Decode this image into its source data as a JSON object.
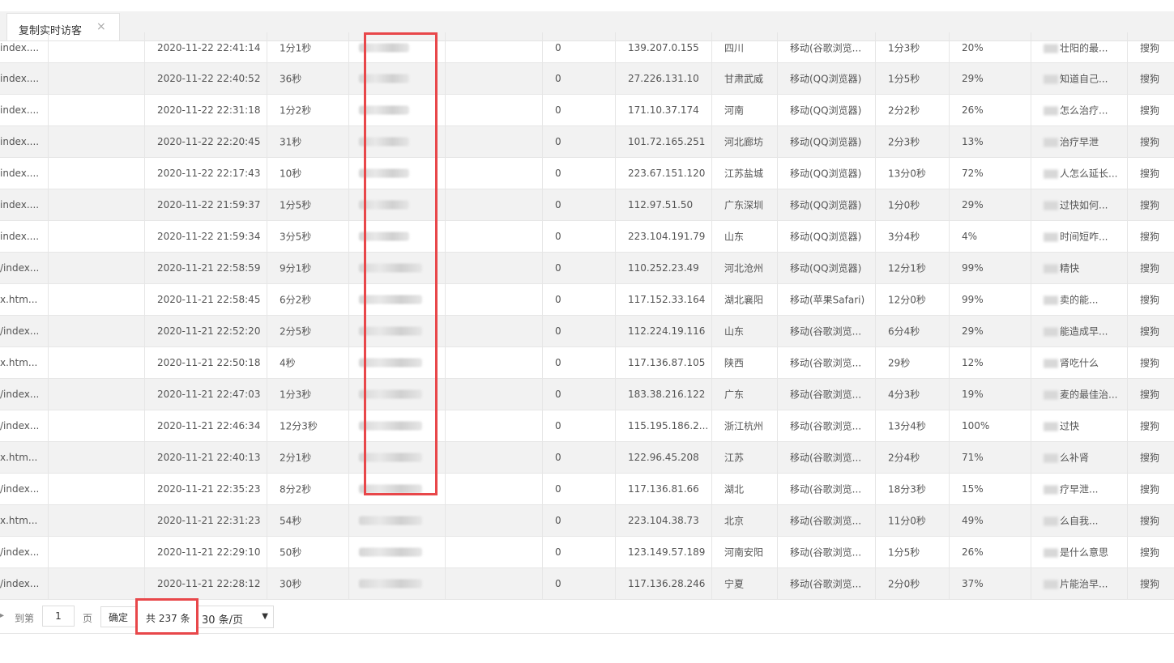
{
  "tab": {
    "label": "复制实时访客",
    "close": "×"
  },
  "rows": [
    {
      "page": "index....",
      "time": "2020-11-22 22:41:14",
      "dur": "1分1秒",
      "visits": "0",
      "ip": "139.207.0.155",
      "region": "四川",
      "client": "移动(谷歌浏览...",
      "stay": "1分3秒",
      "rate": "20%",
      "kw": "壮阳的最...",
      "engine": "搜狗"
    },
    {
      "page": "index....",
      "time": "2020-11-22 22:40:52",
      "dur": "36秒",
      "visits": "0",
      "ip": "27.226.131.10",
      "region": "甘肃武威",
      "client": "移动(QQ浏览器)",
      "stay": "1分5秒",
      "rate": "29%",
      "kw": "知道自己...",
      "engine": "搜狗"
    },
    {
      "page": "index....",
      "time": "2020-11-22 22:31:18",
      "dur": "1分2秒",
      "visits": "0",
      "ip": "171.10.37.174",
      "region": "河南",
      "client": "移动(QQ浏览器)",
      "stay": "2分2秒",
      "rate": "26%",
      "kw": "怎么治疗...",
      "engine": "搜狗"
    },
    {
      "page": "index....",
      "time": "2020-11-22 22:20:45",
      "dur": "31秒",
      "visits": "0",
      "ip": "101.72.165.251",
      "region": "河北廊坊",
      "client": "移动(QQ浏览器)",
      "stay": "2分3秒",
      "rate": "13%",
      "kw": "治疗早泄",
      "engine": "搜狗"
    },
    {
      "page": "index....",
      "time": "2020-11-22 22:17:43",
      "dur": "10秒",
      "visits": "0",
      "ip": "223.67.151.120",
      "region": "江苏盐城",
      "client": "移动(QQ浏览器)",
      "stay": "13分0秒",
      "rate": "72%",
      "kw": "人怎么延长...",
      "engine": "搜狗"
    },
    {
      "page": "index....",
      "time": "2020-11-22 21:59:37",
      "dur": "1分5秒",
      "visits": "0",
      "ip": "112.97.51.50",
      "region": "广东深圳",
      "client": "移动(QQ浏览器)",
      "stay": "1分0秒",
      "rate": "29%",
      "kw": "过快如何...",
      "engine": "搜狗"
    },
    {
      "page": "index....",
      "time": "2020-11-22 21:59:34",
      "dur": "3分5秒",
      "visits": "0",
      "ip": "223.104.191.79",
      "region": "山东",
      "client": "移动(QQ浏览器)",
      "stay": "3分4秒",
      "rate": "4%",
      "kw": "时间短咋...",
      "engine": "搜狗"
    },
    {
      "page": "/index...",
      "time": "2020-11-21 22:58:59",
      "dur": "9分1秒",
      "visits": "0",
      "ip": "110.252.23.49",
      "region": "河北沧州",
      "client": "移动(QQ浏览器)",
      "stay": "12分1秒",
      "rate": "99%",
      "kw": "精快",
      "engine": "搜狗"
    },
    {
      "page": "x.htm...",
      "time": "2020-11-21 22:58:45",
      "dur": "6分2秒",
      "visits": "0",
      "ip": "117.152.33.164",
      "region": "湖北襄阳",
      "client": "移动(苹果Safari)",
      "stay": "12分0秒",
      "rate": "99%",
      "kw": "卖的能...",
      "engine": "搜狗"
    },
    {
      "page": "/index...",
      "time": "2020-11-21 22:52:20",
      "dur": "2分5秒",
      "visits": "0",
      "ip": "112.224.19.116",
      "region": "山东",
      "client": "移动(谷歌浏览...",
      "stay": "6分4秒",
      "rate": "29%",
      "kw": "能造成早...",
      "engine": "搜狗"
    },
    {
      "page": "x.htm...",
      "time": "2020-11-21 22:50:18",
      "dur": "4秒",
      "visits": "0",
      "ip": "117.136.87.105",
      "region": "陕西",
      "client": "移动(谷歌浏览...",
      "stay": "29秒",
      "rate": "12%",
      "kw": "肾吃什么",
      "engine": "搜狗"
    },
    {
      "page": "/index...",
      "time": "2020-11-21 22:47:03",
      "dur": "1分3秒",
      "visits": "0",
      "ip": "183.38.216.122",
      "region": "广东",
      "client": "移动(谷歌浏览...",
      "stay": "4分3秒",
      "rate": "19%",
      "kw": "麦的最佳治...",
      "engine": "搜狗"
    },
    {
      "page": "/index...",
      "time": "2020-11-21 22:46:34",
      "dur": "12分3秒",
      "visits": "0",
      "ip": "115.195.186.2...",
      "region": "浙江杭州",
      "client": "移动(谷歌浏览...",
      "stay": "13分4秒",
      "rate": "100%",
      "kw": "过快",
      "engine": "搜狗"
    },
    {
      "page": "x.htm...",
      "time": "2020-11-21 22:40:13",
      "dur": "2分1秒",
      "visits": "0",
      "ip": "122.96.45.208",
      "region": "江苏",
      "client": "移动(谷歌浏览...",
      "stay": "2分4秒",
      "rate": "71%",
      "kw": "么补肾",
      "engine": "搜狗"
    },
    {
      "page": "/index...",
      "time": "2020-11-21 22:35:23",
      "dur": "8分2秒",
      "visits": "0",
      "ip": "117.136.81.66",
      "region": "湖北",
      "client": "移动(谷歌浏览...",
      "stay": "18分3秒",
      "rate": "15%",
      "kw": "疗早泄...",
      "engine": "搜狗"
    },
    {
      "page": "x.htm...",
      "time": "2020-11-21 22:31:23",
      "dur": "54秒",
      "visits": "0",
      "ip": "223.104.38.73",
      "region": "北京",
      "client": "移动(谷歌浏览...",
      "stay": "11分0秒",
      "rate": "49%",
      "kw": "么自我...",
      "engine": "搜狗"
    },
    {
      "page": "/index...",
      "time": "2020-11-21 22:29:10",
      "dur": "50秒",
      "visits": "0",
      "ip": "123.149.57.189",
      "region": "河南安阳",
      "client": "移动(谷歌浏览...",
      "stay": "1分5秒",
      "rate": "26%",
      "kw": "是什么意思",
      "engine": "搜狗"
    },
    {
      "page": "/index...",
      "time": "2020-11-21 22:28:12",
      "dur": "30秒",
      "visits": "0",
      "ip": "117.136.28.246",
      "region": "宁夏",
      "client": "移动(谷歌浏览...",
      "stay": "2分0秒",
      "rate": "37%",
      "kw": "片能治早...",
      "engine": "搜狗"
    }
  ],
  "pager": {
    "arrow": "▸",
    "goto_label": "到第",
    "page_value": "1",
    "page_suffix": "页",
    "confirm": "确定",
    "total": "共 237 条",
    "page_size": "30 条/页",
    "caret": "▼"
  },
  "colors": {
    "highlight": "#e8474a",
    "row_alt": "#f2f2f2"
  }
}
